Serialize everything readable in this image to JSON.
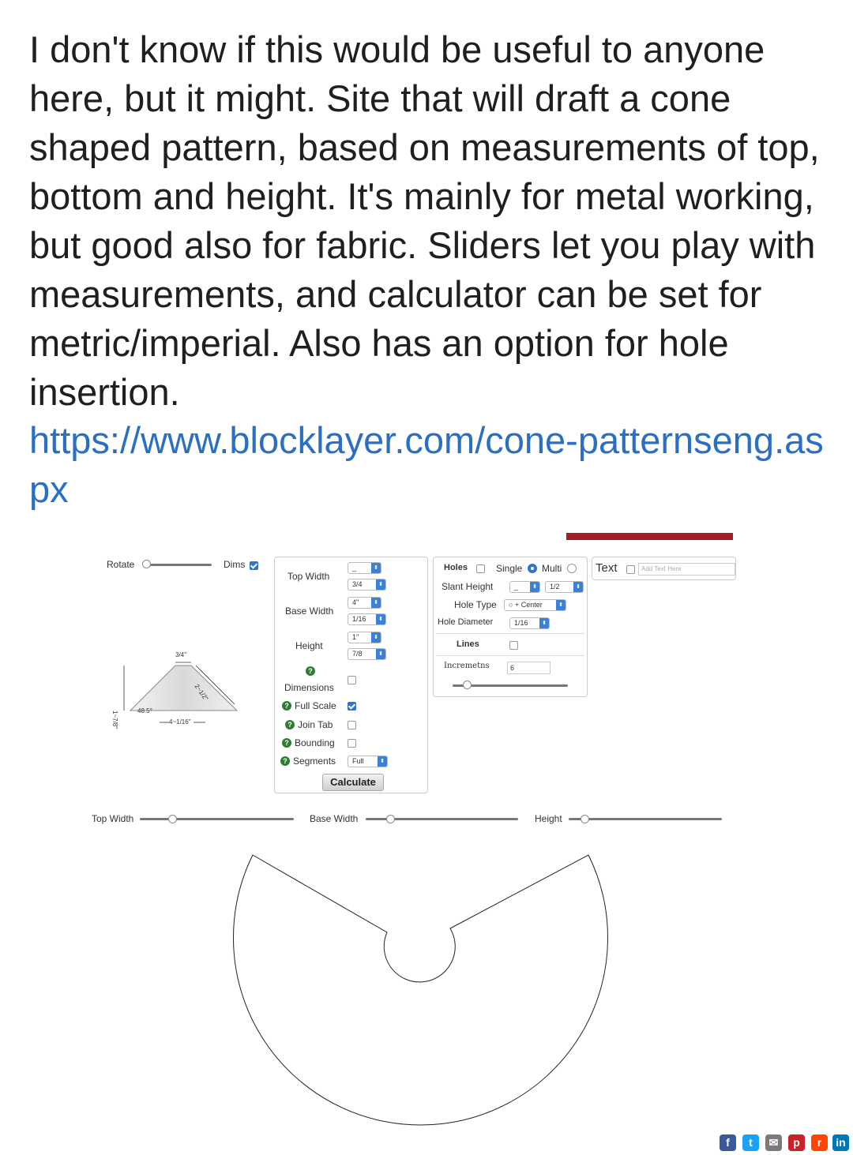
{
  "post": {
    "text": "I don't know if this would be useful to anyone here, but it might. Site that will draft a cone shaped pattern, based on measurements of top, bottom and height. It's mainly for metal working, but good also for fabric. Sliders let you play with measurements, and calculator can be set for metric/imperial. Also has an option for hole insertion.",
    "link": "https://www.blocklayer.com/cone-patternseng.aspx"
  },
  "screenshot": {
    "top_left": {
      "rotate_label": "Rotate",
      "dims_label": "Dims",
      "dims_checked": true
    },
    "diagram": {
      "top_dim": "3/4\"",
      "slant_dim": "2~1/2\"",
      "height_dim": "1~7/8\"",
      "base_dim": "4~1/16\"",
      "angle": "48.5°"
    },
    "form": {
      "top_width_label": "Top Width",
      "top_width_whole": "_",
      "top_width_frac": "3/4",
      "base_width_label": "Base Width",
      "base_width_whole": "4\"",
      "base_width_frac": "1/16",
      "height_label": "Height",
      "height_whole": "1\"",
      "height_frac": "7/8",
      "dimensions_label": "Dimensions",
      "full_scale_label": "Full Scale",
      "join_tab_label": "Join Tab",
      "bounding_label": "Bounding",
      "segments_label": "Segments",
      "segments_value": "Full",
      "calculate_label": "Calculate"
    },
    "holes": {
      "holes_label": "Holes",
      "single_label": "Single",
      "multi_label": "Multi",
      "slant_height_label": "Slant Height",
      "slant_whole": "_",
      "slant_frac": "1/2",
      "hole_type_label": "Hole Type",
      "hole_type_value": "○ + Center",
      "hole_diameter_label": "Hole Diameter",
      "hole_diameter_value": "1/16",
      "lines_label": "Lines",
      "increments_label": "Incremetns",
      "increments_value": "6"
    },
    "text_panel": {
      "label": "Text",
      "placeholder": "Add Text Here"
    },
    "sliders": {
      "top_width_label": "Top Width",
      "base_width_label": "Base Width",
      "height_label": "Height"
    }
  },
  "share_icons": [
    "facebook-icon",
    "twitter-icon",
    "email-icon",
    "pinterest-icon",
    "reddit-icon",
    "linkedin-icon"
  ],
  "share_glyphs": {
    "facebook": "f",
    "twitter": "t",
    "email": "✉",
    "pinterest": "p",
    "reddit": "r",
    "linkedin": "in"
  },
  "colors": {
    "link": "#2a6fc4",
    "accent_blue": "#2f74d0",
    "red_bar": "#a51d24",
    "help_green": "#2e7d32"
  }
}
